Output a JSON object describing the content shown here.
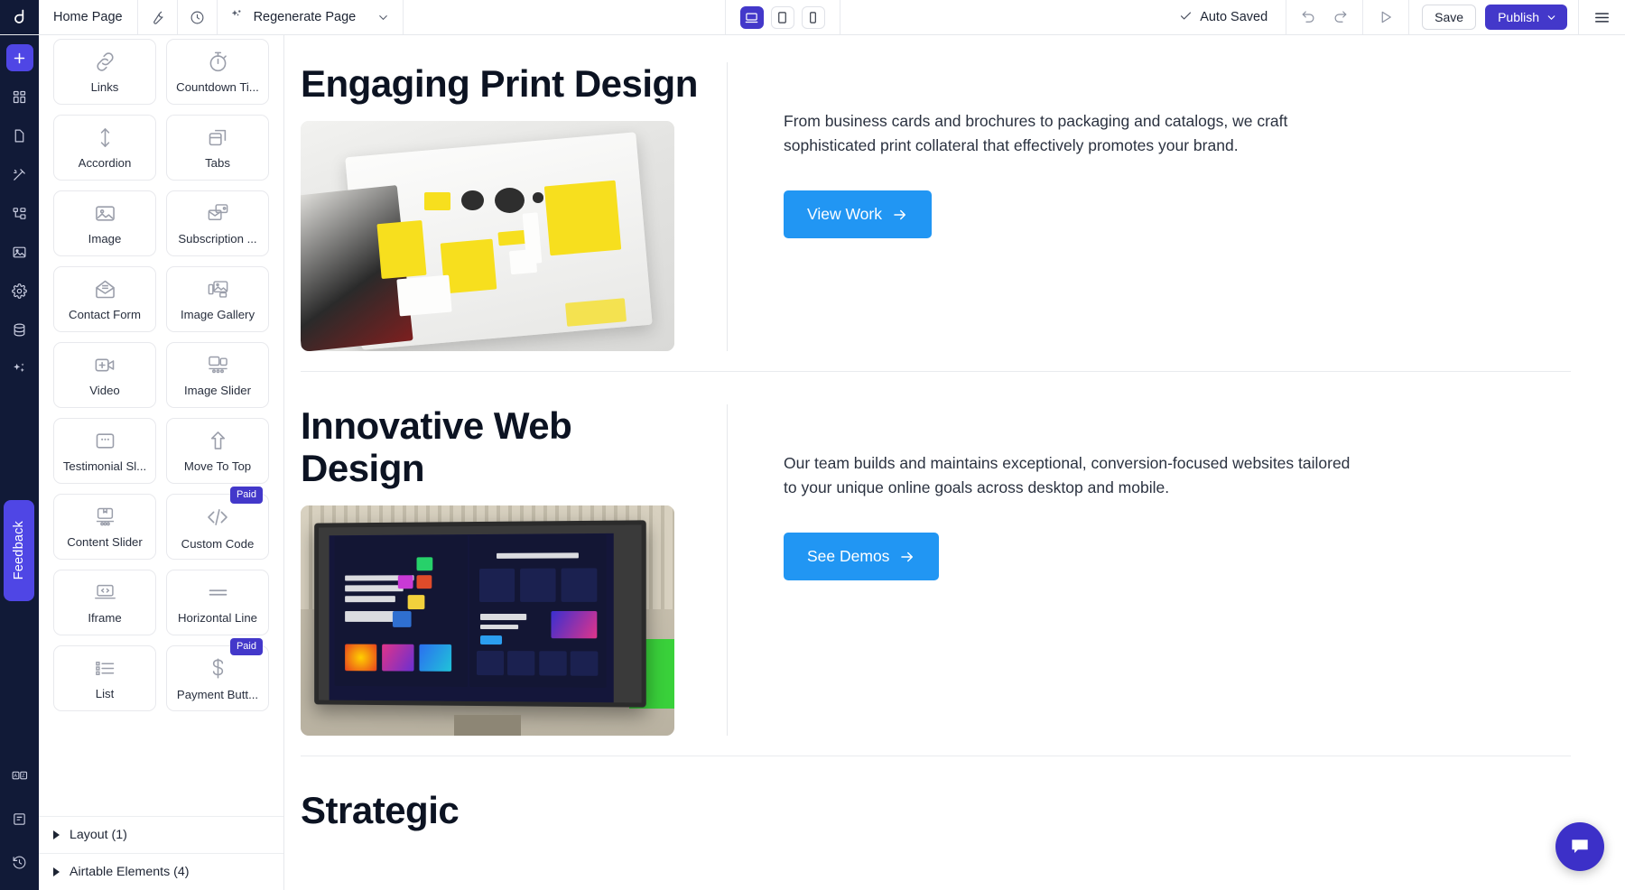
{
  "topbar": {
    "page_name": "Home Page",
    "wrench_icon": "wrench-icon",
    "history_icon": "history-clock-icon",
    "regenerate_label": "Regenerate Page",
    "regenerate_icon": "sparkle-icon",
    "regenerate_caret": "chevron-down-icon",
    "viewports": [
      {
        "name": "desktop",
        "icon": "desktop-icon",
        "active": true
      },
      {
        "name": "tablet",
        "icon": "tablet-icon",
        "active": false
      },
      {
        "name": "mobile",
        "icon": "mobile-icon",
        "active": false
      }
    ],
    "autosaved_label": "Auto Saved",
    "autosaved_icon": "check-icon",
    "undo_icon": "undo-icon",
    "redo_icon": "redo-icon",
    "preview_icon": "play-triangle-icon",
    "save_label": "Save",
    "publish_label": "Publish",
    "publish_caret": "chevron-down-icon",
    "menu_icon": "hamburger-menu-icon",
    "accent_color": "#4338ca"
  },
  "rail": {
    "items": [
      {
        "name": "add",
        "icon": "plus-icon",
        "active": true
      },
      {
        "name": "sections",
        "icon": "grid-blocks-icon",
        "active": false
      },
      {
        "name": "pages",
        "icon": "page-icon",
        "active": false
      },
      {
        "name": "theme",
        "icon": "magic-wand-icon",
        "active": false
      },
      {
        "name": "structure",
        "icon": "sitemap-icon",
        "active": false
      },
      {
        "name": "media",
        "icon": "image-icon",
        "active": false
      },
      {
        "name": "settings",
        "icon": "gear-icon",
        "active": false
      },
      {
        "name": "data",
        "icon": "database-icon",
        "active": false
      },
      {
        "name": "ai",
        "icon": "sparkles-icon",
        "active": false
      }
    ],
    "feedback_label": "Feedback",
    "bottom_items": [
      {
        "name": "language",
        "icon": "language-az-icon"
      },
      {
        "name": "notes",
        "icon": "document-lines-icon"
      },
      {
        "name": "history",
        "icon": "restore-clock-icon"
      }
    ],
    "bg_color": "#111a37",
    "accent_color": "#4f46e5"
  },
  "panel": {
    "widgets": [
      {
        "label": "Links",
        "icon": "chain-links-icon",
        "paid": false
      },
      {
        "label": "Countdown Ti...",
        "icon": "stopwatch-icon",
        "paid": false
      },
      {
        "label": "Accordion",
        "icon": "up-down-arrow-icon",
        "paid": false
      },
      {
        "label": "Tabs",
        "icon": "tabs-icon",
        "paid": false
      },
      {
        "label": "Image",
        "icon": "picture-icon",
        "paid": false
      },
      {
        "label": "Subscription ...",
        "icon": "envelope-cards-icon",
        "paid": false
      },
      {
        "label": "Contact Form",
        "icon": "open-envelope-icon",
        "paid": false
      },
      {
        "label": "Image Gallery",
        "icon": "gallery-icon",
        "paid": false
      },
      {
        "label": "Video",
        "icon": "video-plus-icon",
        "paid": false
      },
      {
        "label": "Image Slider",
        "icon": "image-slider-icon",
        "paid": false
      },
      {
        "label": "Testimonial Sl...",
        "icon": "testimonial-card-icon",
        "paid": false
      },
      {
        "label": "Move To Top",
        "icon": "arrow-up-icon",
        "paid": false
      },
      {
        "label": "Content Slider",
        "icon": "content-slider-icon",
        "paid": false
      },
      {
        "label": "Custom Code",
        "icon": "code-brackets-icon",
        "paid": true,
        "badge": "Paid"
      },
      {
        "label": "Iframe",
        "icon": "laptop-code-icon",
        "paid": false
      },
      {
        "label": "Horizontal Line",
        "icon": "horizontal-line-icon",
        "paid": false
      },
      {
        "label": "List",
        "icon": "bullet-list-icon",
        "paid": false
      },
      {
        "label": "Payment Butt...",
        "icon": "dollar-sign-icon",
        "paid": true,
        "badge": "Paid"
      }
    ],
    "sections": [
      {
        "label": "Layout (1)",
        "icon": "caret-right-icon"
      },
      {
        "label": "Airtable Elements (4)",
        "icon": "caret-right-icon"
      }
    ]
  },
  "canvas": {
    "sections": [
      {
        "title": "Engaging Print Design",
        "body": "From business cards and brochures to packaging and catalogs, we craft sophisticated print collateral that effectively promotes your brand.",
        "cta_label": "View Work",
        "cta_icon": "arrow-right-icon",
        "cta_color": "#2196f3",
        "image_alt": "print-design-brochure-photo"
      },
      {
        "title": "Innovative Web Design",
        "body": "Our team builds and maintains exceptional, conversion-focused websites tailored to your unique online goals across desktop and mobile.",
        "cta_label": "See Demos",
        "cta_icon": "arrow-right-icon",
        "cta_color": "#2196f3",
        "image_alt": "monitor-web-design-photo"
      }
    ],
    "next_section_title": "Strategic",
    "chat_icon": "chat-bubble-icon",
    "chat_color": "#3c30c8"
  }
}
